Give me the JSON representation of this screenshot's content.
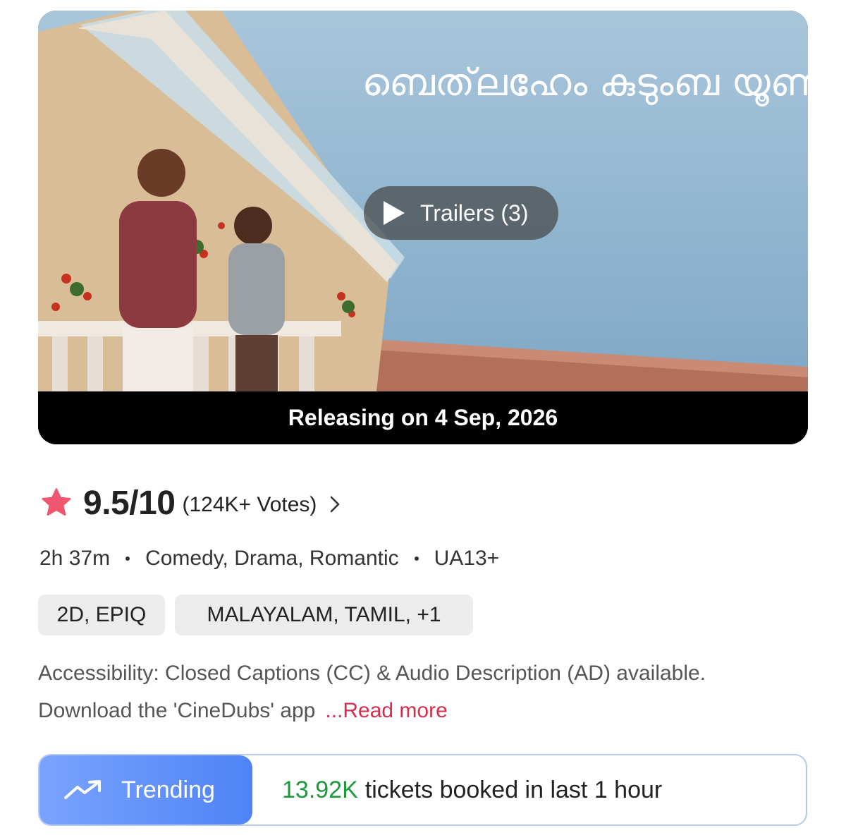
{
  "banner": {
    "poster_title_malayalam": "ബെത്‌ലഹേം കുടുംബ യൂണിറ്റ്",
    "trailers_label": "Trailers (3)",
    "release_text": "Releasing on 4 Sep, 2026"
  },
  "rating": {
    "score": "9.5/10",
    "votes": "(124K+ Votes)",
    "star_color": "#f0566f"
  },
  "meta": {
    "duration": "2h 37m",
    "genres": "Comedy, Drama, Romantic",
    "certificate": "UA13+"
  },
  "chips": {
    "format": "2D, EPIQ",
    "languages": "MALAYALAM, TAMIL,  +1"
  },
  "accessibility": {
    "line1": "Accessibility: Closed Captions (CC) & Audio Description (AD) available.",
    "line2": "Download the 'CineDubs' app",
    "read_more": "...Read more"
  },
  "trending": {
    "badge_label": "Trending",
    "count": "13.92K",
    "text": "tickets booked in last 1 hour",
    "count_color": "#1d9a3a",
    "badge_color": "#5a8cf7"
  },
  "icons": {
    "play": "play-icon",
    "star": "star-icon",
    "chevron": "chevron-right-icon",
    "trend": "trending-up-icon"
  }
}
